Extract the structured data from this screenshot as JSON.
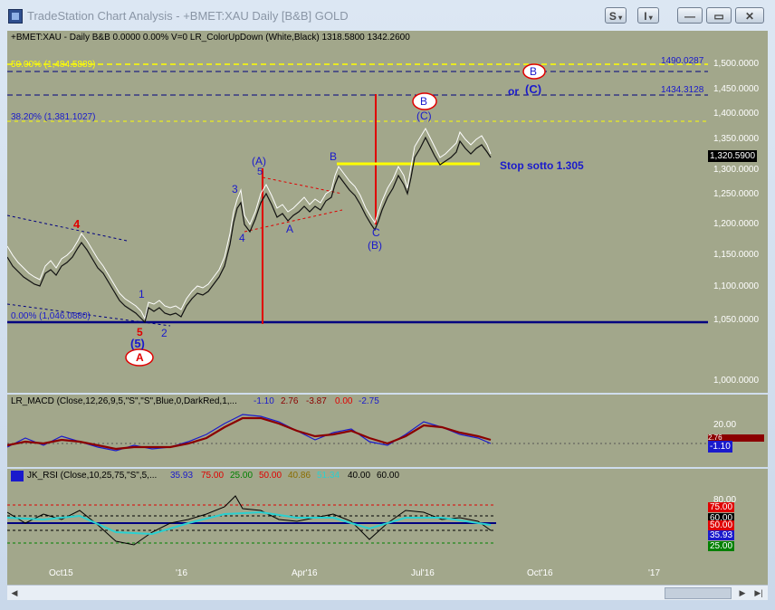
{
  "window": {
    "title": "TradeStation Chart Analysis - +BMET:XAU Daily [B&B] GOLD",
    "buttons": [
      "S",
      "I"
    ]
  },
  "price_pane": {
    "header": "+BMET:XAU - Daily  B&B  0.0000  0.00%  V=0   LR_ColorUpDown (White,Black)   1318.5800  1342.2600",
    "fib_50": "50.00% (1,484.5889)",
    "fib_382": "38.20% (1,381.1027)",
    "fib_0": "0.00% (1,046.0880)",
    "level_top": "1490.0287",
    "level_mid": "1434.3128",
    "stop_text": "Stop sotto 1.305",
    "last_price": "1,320.5900",
    "wave_labels": {
      "w4": "4",
      "w5a": "5",
      "w5_paren": "(5)",
      "wA_circle": "A",
      "w1": "1",
      "w2": "2",
      "w3": "3",
      "w4b": "4",
      "wA_paren": "(A)",
      "w5b": "5",
      "wA": "A",
      "wB": "B",
      "wC": "C",
      "wB_paren": "(B)",
      "wB_circle": "B",
      "wC_paren": "(C)",
      "wB_circle_top": "B",
      "or": "or",
      "wC_paren_top": "(C)"
    },
    "y_ticks": [
      "1,500.0000",
      "1,450.0000",
      "1,400.0000",
      "1,350.0000",
      "1,300.0000",
      "1,250.0000",
      "1,200.0000",
      "1,150.0000",
      "1,100.0000",
      "1,050.0000",
      "1,000.0000"
    ]
  },
  "macd_pane": {
    "header_name": "LR_MACD (Close,12,26,9,5,\"S\",\"S\",Blue,0,DarkRed,1,...",
    "values": [
      "-1.10",
      "2.76",
      "-3.87",
      "0.00",
      "-2.75"
    ],
    "y_ticks": [
      "20.00"
    ],
    "current": "-1.10",
    "tag_partial": "2.76"
  },
  "rsi_pane": {
    "header_name": "JK_RSI (Close,10,25,75,\"S\",5,...",
    "values": [
      "35.93",
      "75.00",
      "25.00",
      "50.00",
      "40.86",
      "51.34",
      "40.00",
      "60.00"
    ],
    "y_ticks": [
      "80.00"
    ],
    "tags": [
      "75.00",
      "60.00",
      "50.00",
      "35.93",
      "25.00"
    ]
  },
  "time_axis": {
    "labels": [
      "Oct15",
      "'16",
      "Apr'16",
      "Jul'16",
      "Oct'16",
      "'17"
    ]
  },
  "colors": {
    "pane_bg": "#a2a78b",
    "blue_label": "#1a1acc",
    "red": "#e00000",
    "yellow": "#ffff00",
    "navy_line": "#000080"
  }
}
